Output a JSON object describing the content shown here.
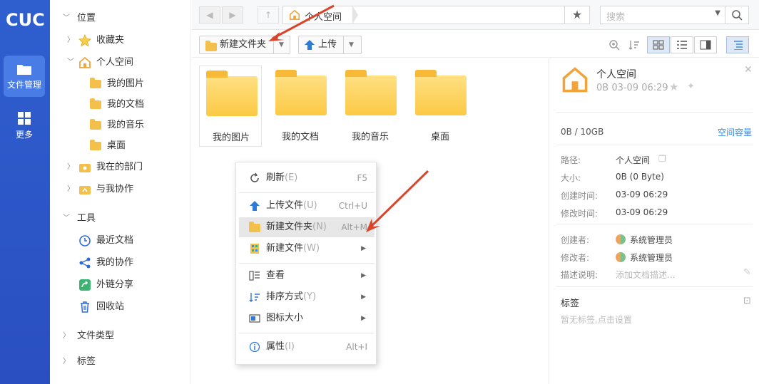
{
  "rail": {
    "logo": "CUC",
    "items": [
      {
        "label": "文件管理"
      },
      {
        "label": "更多"
      }
    ]
  },
  "tree": {
    "location_header": "位置",
    "favorites": "收藏夹",
    "personal_space": "个人空间",
    "personal_children": [
      "我的图片",
      "我的文档",
      "我的音乐",
      "桌面"
    ],
    "my_department": "我在的部门",
    "collab_with_me": "与我协作",
    "tools_header": "工具",
    "tools": [
      "最近文档",
      "我的协作",
      "外链分享",
      "回收站"
    ],
    "file_types": "文件类型",
    "tags": "标签"
  },
  "topbar": {
    "breadcrumb": "个人空间",
    "search_placeholder": "搜索"
  },
  "toolbar": {
    "new_folder": "新建文件夹",
    "upload": "上传"
  },
  "files": [
    {
      "name": "我的图片"
    },
    {
      "name": "我的文档"
    },
    {
      "name": "我的音乐"
    },
    {
      "name": "桌面"
    }
  ],
  "context_menu": {
    "items": [
      {
        "label": "刷新",
        "key": "(E)",
        "shortcut": "F5"
      },
      {
        "label": "上传文件",
        "key": "(U)",
        "shortcut": "Ctrl+U"
      },
      {
        "label": "新建文件夹",
        "key": "(N)",
        "shortcut": "Alt+M"
      },
      {
        "label": "新建文件",
        "key": "(W)",
        "shortcut": ""
      },
      {
        "label": "查看",
        "key": "",
        "shortcut": ""
      },
      {
        "label": "排序方式",
        "key": "(Y)",
        "shortcut": ""
      },
      {
        "label": "图标大小",
        "key": "",
        "shortcut": ""
      },
      {
        "label": "属性",
        "key": "(I)",
        "shortcut": "Alt+I"
      }
    ]
  },
  "panel": {
    "title": "个人空间",
    "meta": "0B 03-09 06:29",
    "quota": "0B / 10GB",
    "quota_link": "空间容量",
    "props": [
      {
        "label": "路径:",
        "value": "个人空间"
      },
      {
        "label": "大小:",
        "value": "0B (0 Byte)"
      },
      {
        "label": "创建时间:",
        "value": "03-09 06:29"
      },
      {
        "label": "修改时间:",
        "value": "03-09 06:29"
      }
    ],
    "creator_label": "创建者:",
    "creator": "系统管理员",
    "modifier_label": "修改者:",
    "modifier": "系统管理员",
    "desc_label": "描述说明:",
    "desc_placeholder": "添加文档描述...",
    "tags_title": "标签",
    "tags_empty": "暂无标签,点击设置"
  },
  "colors": {
    "rail": "#2f5fcf",
    "accent": "#3a8ee6",
    "folder": "#fcc944",
    "arrow": "#d9452b"
  }
}
